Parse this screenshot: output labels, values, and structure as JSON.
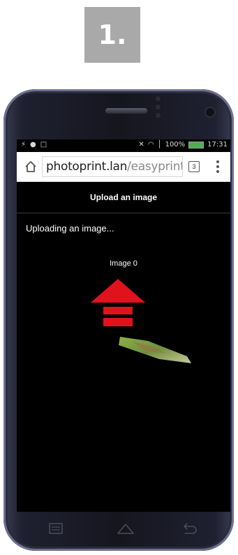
{
  "step": {
    "label": "1."
  },
  "status_bar": {
    "time": "17:31",
    "battery": "100%"
  },
  "browser": {
    "url_host": "photoprint.lan",
    "url_path": "/easyprint",
    "tab_count": "3"
  },
  "page": {
    "title": "Upload an image",
    "status": "Uploading an image...",
    "image_label": "Image 0"
  },
  "colors": {
    "arrow": "#e0121b",
    "step_badge": "#a9a9a9",
    "screen_bg": "#000000"
  },
  "icons": {
    "home": "home-icon",
    "tabs": "tab-switcher-icon",
    "menu": "overflow-menu-icon",
    "upload": "upload-arrow-icon",
    "nav_recent": "recent-apps-icon",
    "nav_home": "nav-home-icon",
    "nav_back": "back-icon"
  }
}
